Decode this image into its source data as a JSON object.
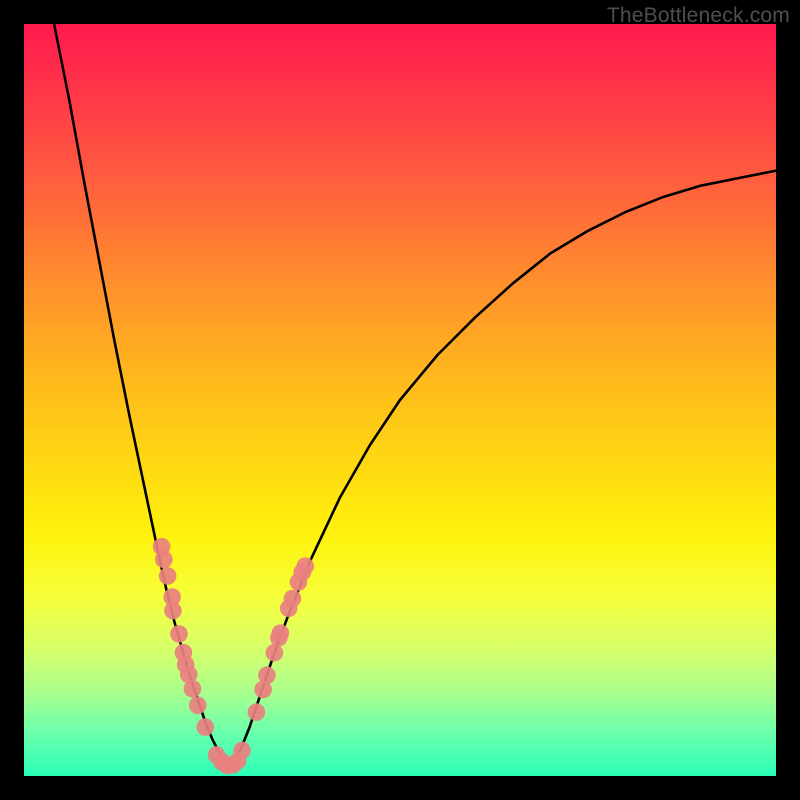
{
  "watermark": "TheBottleneck.com",
  "chart_data": {
    "type": "line",
    "title": "",
    "xlabel": "",
    "ylabel": "",
    "xlim": [
      0,
      100
    ],
    "ylim": [
      0,
      100
    ],
    "series": [
      {
        "name": "curve-left",
        "x": [
          4,
          6,
          8,
          10,
          12,
          14,
          16,
          18,
          19,
          20,
          21,
          22,
          23,
          24,
          25,
          26,
          27
        ],
        "y": [
          100,
          90,
          79,
          68.5,
          58,
          48,
          38.5,
          29,
          24.5,
          20.5,
          17,
          13.5,
          10.5,
          7.5,
          5,
          3,
          1.5
        ]
      },
      {
        "name": "curve-right",
        "x": [
          27,
          28,
          29,
          30,
          31,
          32,
          33,
          35,
          38,
          42,
          46,
          50,
          55,
          60,
          65,
          70,
          75,
          80,
          85,
          90,
          95,
          100
        ],
        "y": [
          1.5,
          2,
          4,
          6.5,
          9.5,
          12.5,
          15.5,
          21,
          28.5,
          37,
          44,
          50,
          56,
          61,
          65.5,
          69.5,
          72.5,
          75,
          77,
          78.5,
          79.5,
          80.5
        ]
      }
    ],
    "scatter": [
      {
        "x": 18.3,
        "y": 30.5
      },
      {
        "x": 18.6,
        "y": 28.8
      },
      {
        "x": 19.1,
        "y": 26.6
      },
      {
        "x": 19.7,
        "y": 23.8
      },
      {
        "x": 19.8,
        "y": 22.0
      },
      {
        "x": 20.6,
        "y": 18.9
      },
      {
        "x": 21.2,
        "y": 16.4
      },
      {
        "x": 21.5,
        "y": 14.8
      },
      {
        "x": 21.9,
        "y": 13.5
      },
      {
        "x": 22.4,
        "y": 11.6
      },
      {
        "x": 23.1,
        "y": 9.4
      },
      {
        "x": 24.1,
        "y": 6.5
      },
      {
        "x": 25.6,
        "y": 2.8
      },
      {
        "x": 26.3,
        "y": 1.9
      },
      {
        "x": 27.0,
        "y": 1.4
      },
      {
        "x": 27.8,
        "y": 1.5
      },
      {
        "x": 28.4,
        "y": 2.0
      },
      {
        "x": 29.0,
        "y": 3.4
      },
      {
        "x": 30.9,
        "y": 8.5
      },
      {
        "x": 31.8,
        "y": 11.5
      },
      {
        "x": 32.3,
        "y": 13.4
      },
      {
        "x": 33.3,
        "y": 16.4
      },
      {
        "x": 33.9,
        "y": 18.4
      },
      {
        "x": 34.1,
        "y": 19.0
      },
      {
        "x": 35.2,
        "y": 22.3
      },
      {
        "x": 35.7,
        "y": 23.6
      },
      {
        "x": 36.5,
        "y": 25.8
      },
      {
        "x": 37.0,
        "y": 27.1
      },
      {
        "x": 37.4,
        "y": 27.9
      }
    ],
    "scatter_color": "#e98080",
    "curve_color": "#000000"
  }
}
